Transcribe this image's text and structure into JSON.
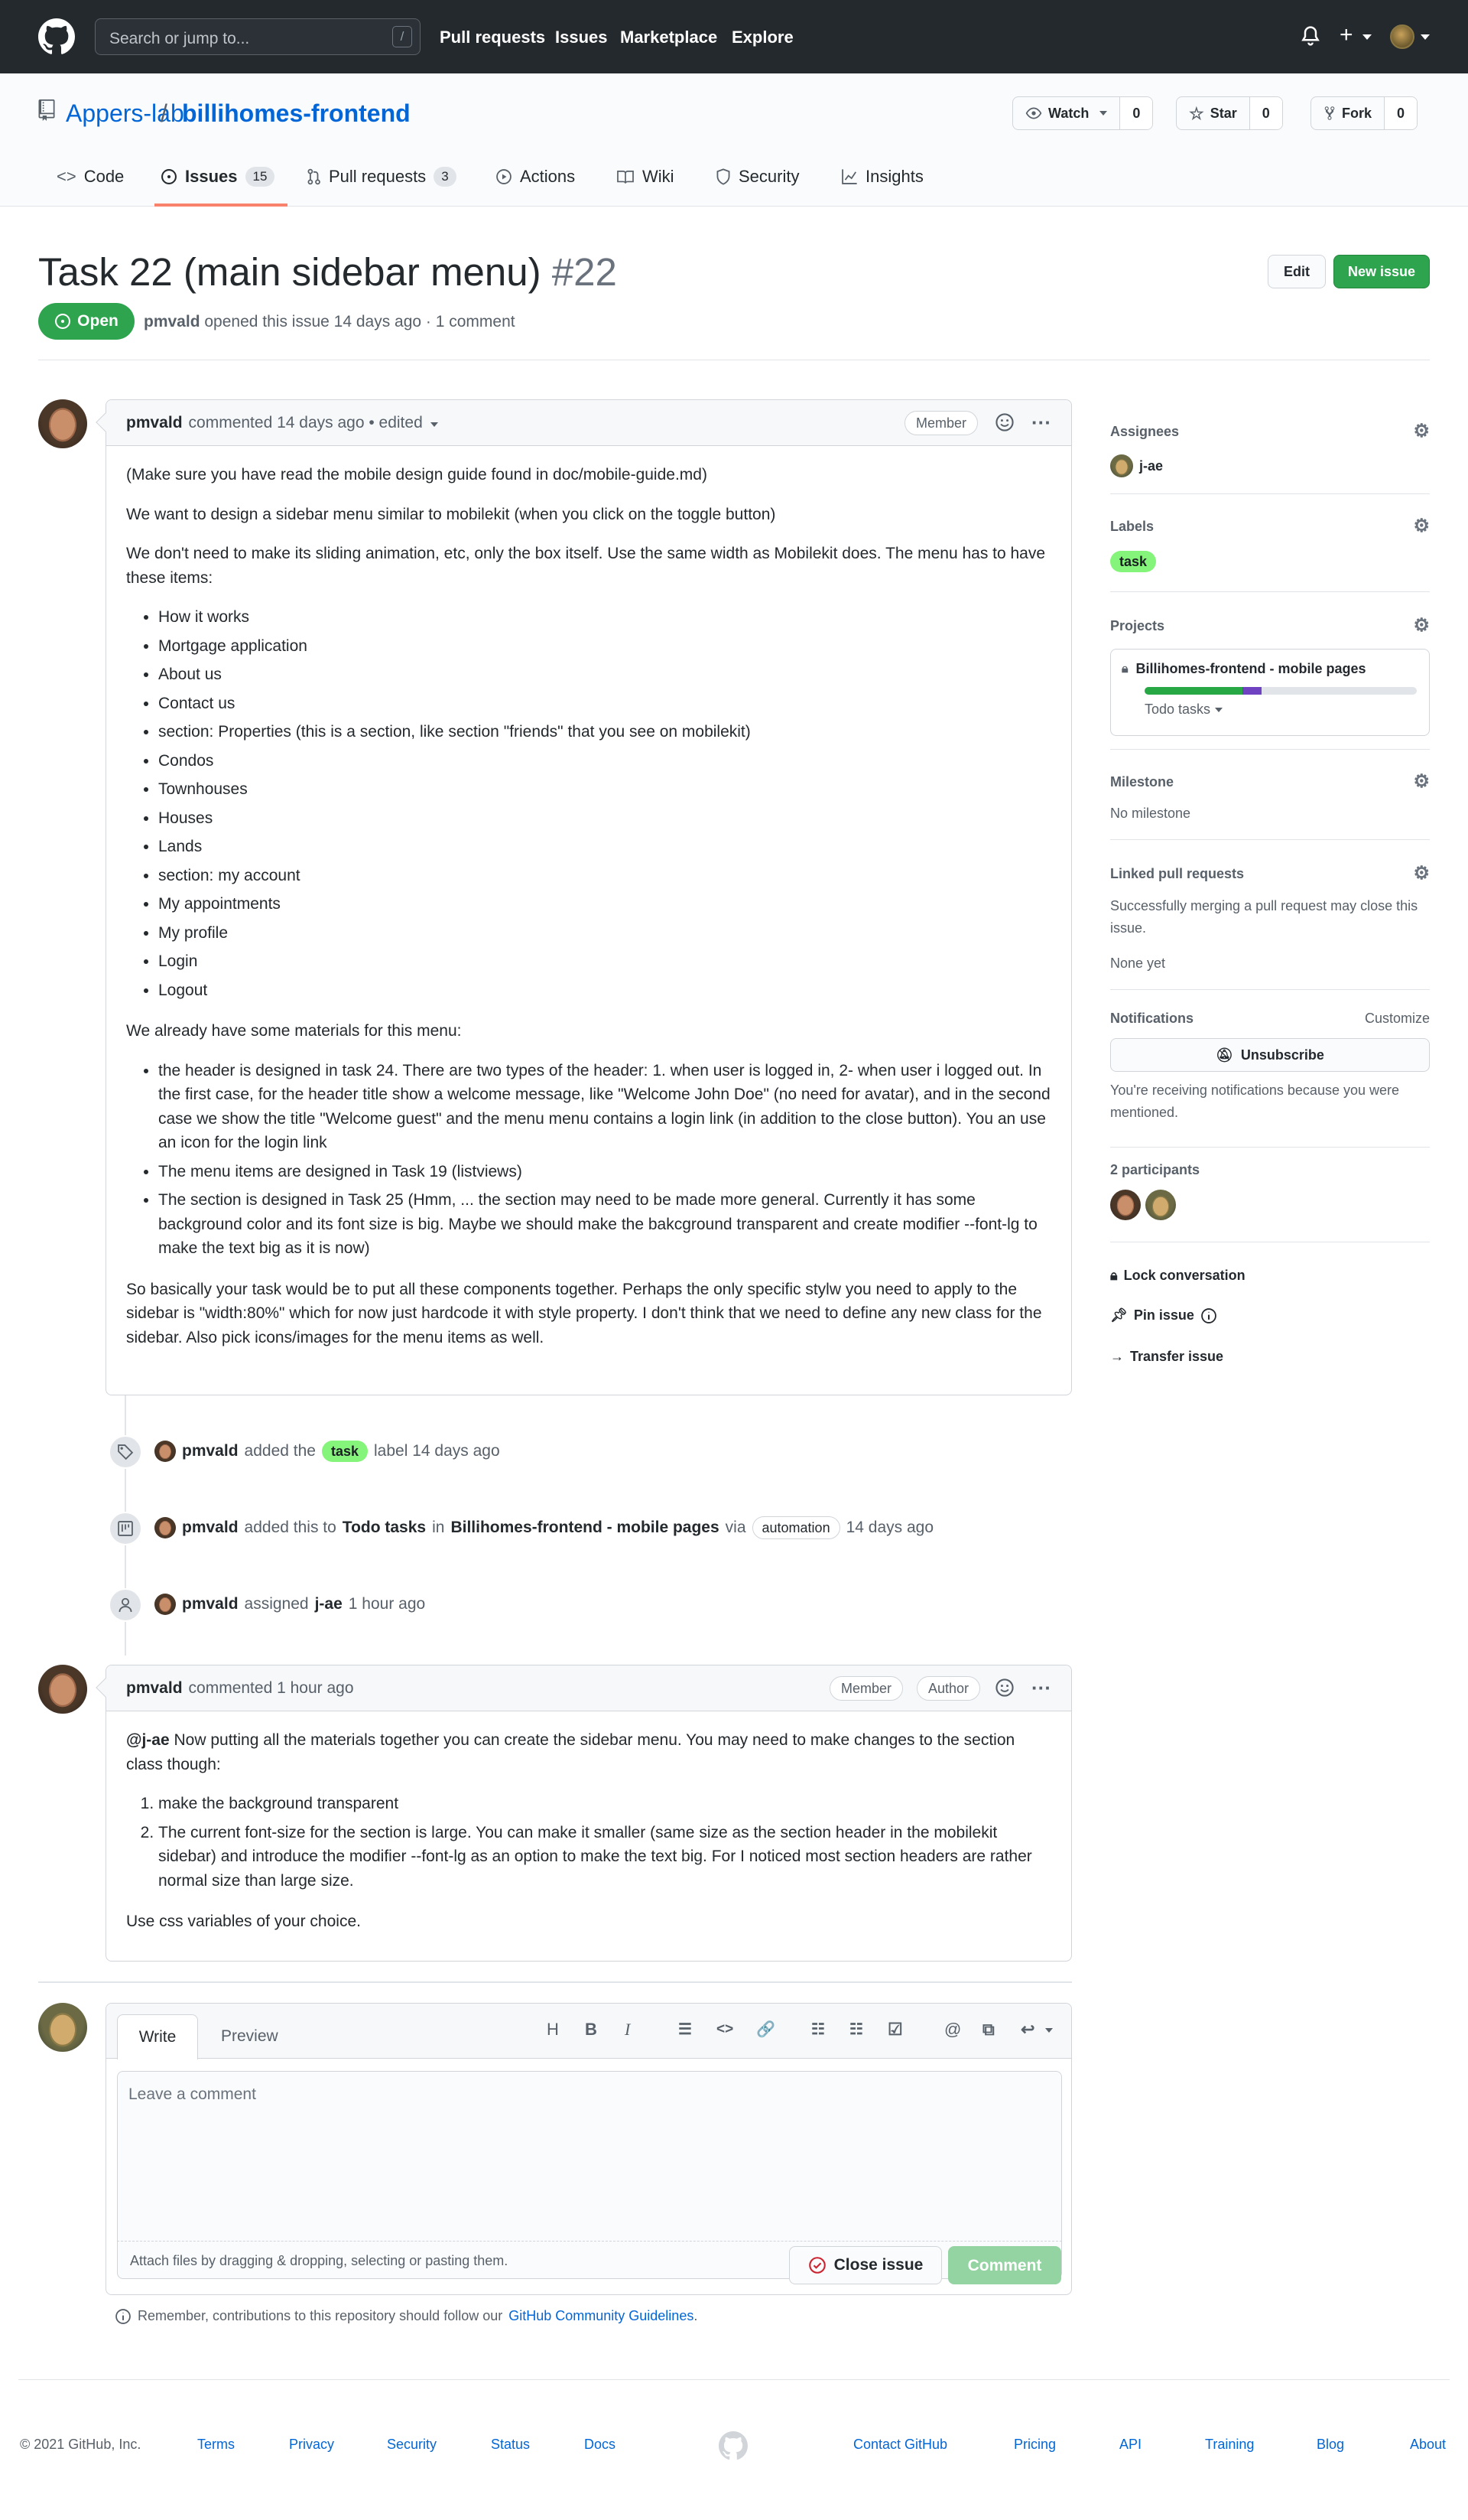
{
  "header": {
    "search_placeholder": "Search or jump to...",
    "search_shortcut": "/",
    "nav": [
      "Pull requests",
      "Issues",
      "Marketplace",
      "Explore"
    ]
  },
  "repo": {
    "owner": "Appers-lab",
    "slash": "/",
    "name": "billihomes-frontend",
    "watch_label": "Watch",
    "watch_count": "0",
    "star_label": "Star",
    "star_count": "0",
    "fork_label": "Fork",
    "fork_count": "0",
    "tabs": [
      {
        "label": "Code"
      },
      {
        "label": "Issues",
        "count": "15"
      },
      {
        "label": "Pull requests",
        "count": "3"
      },
      {
        "label": "Actions"
      },
      {
        "label": "Wiki"
      },
      {
        "label": "Security"
      },
      {
        "label": "Insights"
      }
    ]
  },
  "issue": {
    "title": "Task 22 (main sidebar menu)",
    "number": "#22",
    "edit_label": "Edit",
    "new_issue_label": "New issue",
    "state": "Open",
    "author": "pmvald",
    "meta": "opened this issue 14 days ago · 1 comment"
  },
  "comment1": {
    "author": "pmvald",
    "meta": "commented 14 days ago • edited",
    "role": "Member",
    "p1": "(Make sure you have read the mobile design guide found in doc/mobile-guide.md)",
    "p2": "We want to design a sidebar menu similar to mobilekit (when you click on the toggle button)",
    "p3": "We don't need to make its sliding animation, etc, only the box itself. Use the same width as Mobilekit does. The menu has to have these items:",
    "items": [
      "How it works",
      "Mortgage application",
      "About us",
      "Contact us",
      "section: Properties (this is a section, like section \"friends\" that you see on mobilekit)",
      "Condos",
      "Townhouses",
      "Houses",
      "Lands",
      "section: my account",
      "My appointments",
      "My profile",
      "Login",
      "Logout"
    ],
    "p4": "We already have some materials for this menu:",
    "materials": [
      "the header is designed in task 24. There are two types of the header: 1. when user is logged in, 2- when user i logged out. In the first case, for the header title show a welcome message, like \"Welcome John Doe\" (no need for avatar), and in the second case we show the title \"Welcome guest\" and the menu menu contains a login link (in addition to the close button). You an use an icon for the login link",
      "The menu items are designed in Task 19 (listviews)",
      "The section is designed in Task 25 (Hmm, ... the section may need to be made more general. Currently it has some background color and its font size is big. Maybe we should make the bakcground transparent and create modifier --font-lg to make the text big as it is now)"
    ],
    "p5": "So basically your task would be to put all these components together. Perhaps the only specific stylw you need to apply to the sidebar is \"width:80%\" which for now just hardcode it with style property. I don't think that we need to define any new class for the sidebar. Also pick icons/images for the menu items as well."
  },
  "timeline": {
    "e1": {
      "user": "pmvald",
      "pre": "added the",
      "label": "task",
      "post": "label 14 days ago"
    },
    "e2": {
      "user": "pmvald",
      "pre": "added this to",
      "column": "Todo tasks",
      "in": "in",
      "project": "Billihomes-frontend - mobile pages",
      "via": "via",
      "tag": "automation",
      "post": "14 days ago"
    },
    "e3": {
      "user": "pmvald",
      "pre": "assigned",
      "assignee": "j-ae",
      "post": "1 hour ago"
    }
  },
  "comment2": {
    "author": "pmvald",
    "meta": "commented 1 hour ago",
    "role1": "Member",
    "role2": "Author",
    "mention": "@j-ae",
    "p1": "Now putting all the materials together you can create the sidebar menu. You may need to make changes to the section class though:",
    "items": [
      "make the background transparent",
      "The current font-size for the section is large. You can make it smaller (same size as the section header in the mobilekit sidebar) and introduce the modifier --font-lg as an option to make the text big. For I noticed most section headers are rather normal size than large size."
    ],
    "p2": "Use css variables of your choice."
  },
  "sidebar": {
    "assignees_title": "Assignees",
    "assignee": "j-ae",
    "labels_title": "Labels",
    "label": "task",
    "projects_title": "Projects",
    "project_name": "Billihomes-frontend - mobile pages",
    "project_progress": {
      "done": 0.36,
      "in_progress": 0.07
    },
    "project_column": "Todo tasks",
    "milestone_title": "Milestone",
    "milestone_value": "No milestone",
    "linked_title": "Linked pull requests",
    "linked_desc": "Successfully merging a pull request may close this issue.",
    "linked_value": "None yet",
    "notif_title": "Notifications",
    "notif_customize": "Customize",
    "unsubscribe": "Unsubscribe",
    "notif_desc": "You're receiving notifications because you were mentioned.",
    "participants_title": "2 participants",
    "lock": "Lock conversation",
    "pin": "Pin issue",
    "transfer": "Transfer issue"
  },
  "editor": {
    "tab_write": "Write",
    "tab_preview": "Preview",
    "placeholder": "Leave a comment",
    "attach": "Attach files by dragging & dropping, selecting or pasting them.",
    "close_issue": "Close issue",
    "comment": "Comment",
    "guidelines_pre": "Remember, contributions to this repository should follow our",
    "guidelines_link": "GitHub Community Guidelines",
    "guidelines_post": "."
  },
  "footer": {
    "copyright": "© 2021 GitHub, Inc.",
    "links_left": [
      "Terms",
      "Privacy",
      "Security",
      "Status",
      "Docs"
    ],
    "links_right": [
      "Contact GitHub",
      "Pricing",
      "API",
      "Training",
      "Blog",
      "About"
    ]
  },
  "colors": {
    "header_bg": "#24292e",
    "open_green": "#2ea44f",
    "link": "#0366d6",
    "label_task": "#85f47a",
    "tab_underline": "#f9826c"
  }
}
